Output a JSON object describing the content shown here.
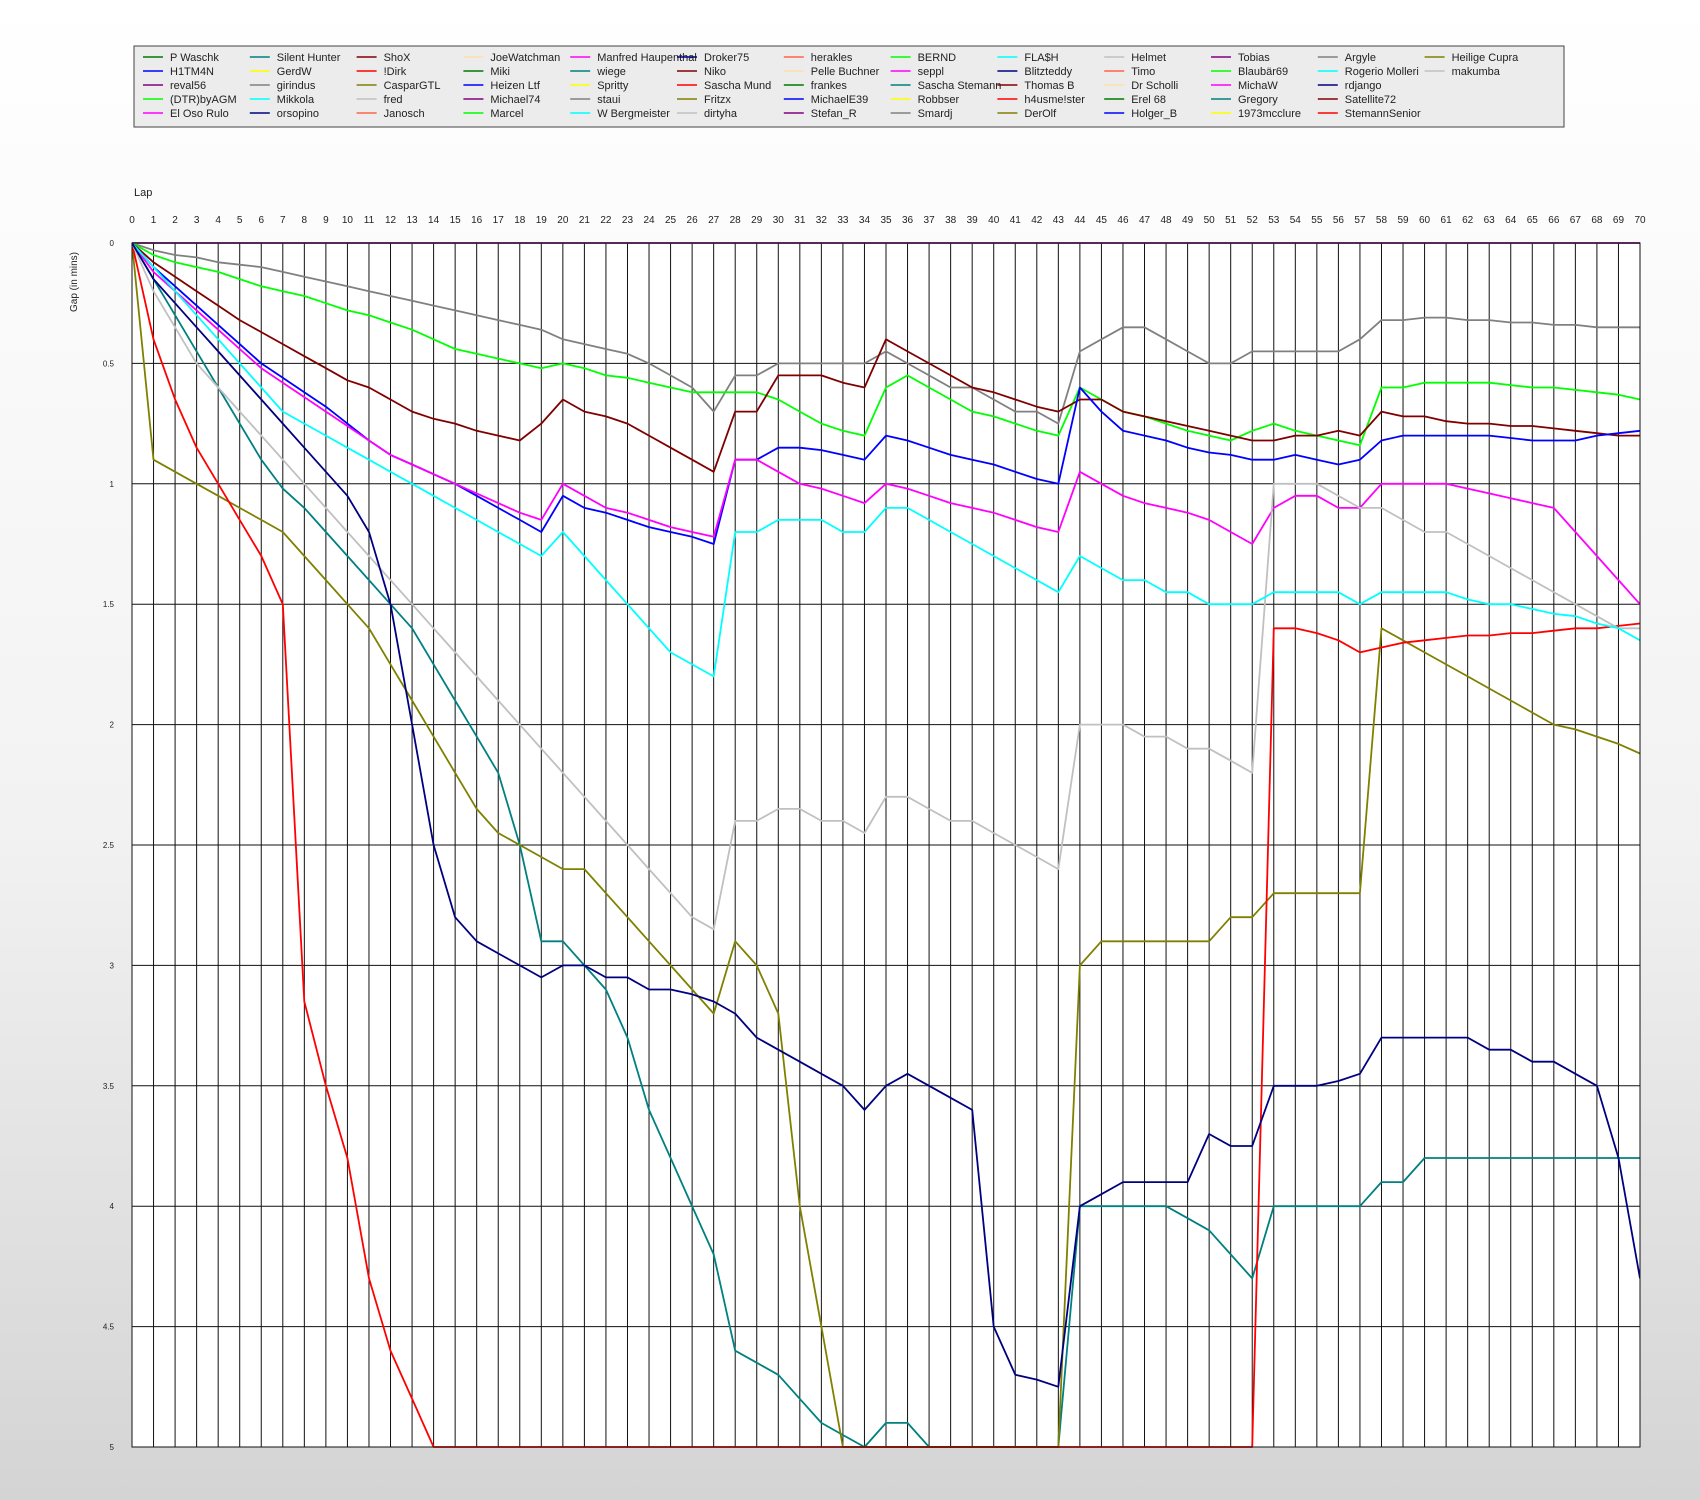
{
  "chart_data": {
    "type": "line",
    "title": "",
    "xlabel": "Lap",
    "ylabel": "Gap (in mins)",
    "x": [
      0,
      1,
      2,
      3,
      4,
      5,
      6,
      7,
      8,
      9,
      10,
      11,
      12,
      13,
      14,
      15,
      16,
      17,
      18,
      19,
      20,
      21,
      22,
      23,
      24,
      25,
      26,
      27,
      28,
      29,
      30,
      31,
      32,
      33,
      34,
      35,
      36,
      37,
      38,
      39,
      40,
      41,
      42,
      43,
      44,
      45,
      46,
      47,
      48,
      49,
      50,
      51,
      52,
      53,
      54,
      55,
      56,
      57,
      58,
      59,
      60,
      61,
      62,
      63,
      64,
      65,
      66,
      67,
      68,
      69,
      70
    ],
    "xlim": [
      0,
      70
    ],
    "ylim": [
      0,
      5
    ],
    "y_inverted": true,
    "yticks": [
      "0",
      "0.5",
      "1",
      "1.5",
      "2",
      "2.5",
      "3",
      "3.5",
      "4",
      "4.5",
      "5"
    ],
    "grid": "vertical line per lap, horizontal line per 0.5",
    "legend_position": "top",
    "legend": [
      {
        "name": "P Waschk",
        "color": "#007800"
      },
      {
        "name": "H1TM4N",
        "color": "#0000ff"
      },
      {
        "name": "reval56",
        "color": "#800080"
      },
      {
        "name": "(DTR)byAGM",
        "color": "#00ff00"
      },
      {
        "name": "El Oso Rulo",
        "color": "#ff00ff"
      },
      {
        "name": "Silent Hunter",
        "color": "#008080"
      },
      {
        "name": "GerdW",
        "color": "#ffff00"
      },
      {
        "name": "girindus",
        "color": "#808080"
      },
      {
        "name": "Mikkola",
        "color": "#00ffff"
      },
      {
        "name": "orsopino",
        "color": "#000080"
      },
      {
        "name": "ShoX",
        "color": "#800000"
      },
      {
        "name": "!Dirk",
        "color": "#ff0000"
      },
      {
        "name": "CasparGTL",
        "color": "#808000"
      },
      {
        "name": "fred",
        "color": "#c0c0c0"
      },
      {
        "name": "Janosch",
        "color": "#ff6347"
      },
      {
        "name": "JoeWatchman",
        "color": "#ffdead"
      },
      {
        "name": "Miki",
        "color": "#007800"
      },
      {
        "name": "Heizen Ltf",
        "color": "#0000ff"
      },
      {
        "name": "Michael74",
        "color": "#800080"
      },
      {
        "name": "Marcel",
        "color": "#00ff00"
      },
      {
        "name": "Manfred Haupenthal",
        "color": "#ff00ff"
      },
      {
        "name": "wiege",
        "color": "#008080"
      },
      {
        "name": "Spritty",
        "color": "#ffff00"
      },
      {
        "name": "staui",
        "color": "#808080"
      },
      {
        "name": "W Bergmeister",
        "color": "#00ffff"
      },
      {
        "name": "Droker75",
        "color": "#000080"
      },
      {
        "name": "Niko",
        "color": "#800000"
      },
      {
        "name": "Sascha Mund",
        "color": "#ff0000"
      },
      {
        "name": "Fritzx",
        "color": "#808000"
      },
      {
        "name": "dirtyha",
        "color": "#c0c0c0"
      },
      {
        "name": "herakles",
        "color": "#ff6347"
      },
      {
        "name": "Pelle Buchner",
        "color": "#ffdead"
      },
      {
        "name": "frankes",
        "color": "#007800"
      },
      {
        "name": "MichaelE39",
        "color": "#0000ff"
      },
      {
        "name": "Stefan_R",
        "color": "#800080"
      },
      {
        "name": "BERND",
        "color": "#00ff00"
      },
      {
        "name": "seppl",
        "color": "#ff00ff"
      },
      {
        "name": "Sascha Stemann",
        "color": "#008080"
      },
      {
        "name": "Robbser",
        "color": "#ffff00"
      },
      {
        "name": "Smardj",
        "color": "#808080"
      },
      {
        "name": "FLA$H",
        "color": "#00ffff"
      },
      {
        "name": "Blitzteddy",
        "color": "#000080"
      },
      {
        "name": "Thomas B",
        "color": "#800000"
      },
      {
        "name": "h4usme!ster",
        "color": "#ff0000"
      },
      {
        "name": "DerOlf",
        "color": "#808000"
      },
      {
        "name": "Helmet",
        "color": "#c0c0c0"
      },
      {
        "name": "Timo",
        "color": "#ff6347"
      },
      {
        "name": "Dr Scholli",
        "color": "#ffdead"
      },
      {
        "name": "Erel 68",
        "color": "#007800"
      },
      {
        "name": "Holger_B",
        "color": "#0000ff"
      },
      {
        "name": "Tobias",
        "color": "#800080"
      },
      {
        "name": "Blaubär69",
        "color": "#00ff00"
      },
      {
        "name": "MichaW",
        "color": "#ff00ff"
      },
      {
        "name": "Gregory",
        "color": "#008080"
      },
      {
        "name": "1973mcclure",
        "color": "#ffff00"
      },
      {
        "name": "Argyle",
        "color": "#808080"
      },
      {
        "name": "Rogerio Molleri",
        "color": "#00ffff"
      },
      {
        "name": "rdjango",
        "color": "#000080"
      },
      {
        "name": "Satellite72",
        "color": "#800000"
      },
      {
        "name": "StemannSenior",
        "color": "#ff0000"
      },
      {
        "name": "Heilige Cupra",
        "color": "#808000"
      },
      {
        "name": "makumba",
        "color": "#c0c0c0"
      }
    ],
    "series": [
      {
        "name": "Tobias",
        "color": "#800080",
        "values": [
          0,
          0,
          0,
          0,
          0,
          0,
          0,
          0,
          0,
          0,
          0,
          0,
          0,
          0,
          0,
          0,
          0,
          0,
          0,
          0,
          0,
          0,
          0,
          0,
          0,
          0,
          0,
          0,
          0,
          0,
          0,
          0,
          0,
          0,
          0,
          0,
          0,
          0,
          0,
          0,
          0,
          0,
          0,
          0,
          0,
          0,
          0,
          0,
          0,
          0,
          0,
          0,
          0,
          0,
          0,
          0,
          0,
          0,
          0,
          0,
          0,
          0,
          0,
          0,
          0,
          0,
          0,
          0,
          0,
          0,
          0
        ]
      },
      {
        "name": "Argyle",
        "color": "#808080",
        "values": [
          0,
          0.03,
          0.05,
          0.06,
          0.08,
          0.09,
          0.1,
          0.12,
          0.14,
          0.16,
          0.18,
          0.2,
          0.22,
          0.24,
          0.26,
          0.28,
          0.3,
          0.32,
          0.34,
          0.36,
          0.4,
          0.42,
          0.44,
          0.46,
          0.5,
          0.55,
          0.6,
          0.7,
          0.55,
          0.55,
          0.5,
          0.5,
          0.5,
          0.5,
          0.5,
          0.45,
          0.5,
          0.55,
          0.6,
          0.6,
          0.65,
          0.7,
          0.7,
          0.75,
          0.45,
          0.4,
          0.35,
          0.35,
          0.4,
          0.45,
          0.5,
          0.5,
          0.45,
          0.45,
          0.45,
          0.45,
          0.45,
          0.4,
          0.32,
          0.32,
          0.31,
          0.31,
          0.32,
          0.32,
          0.33,
          0.33,
          0.34,
          0.34,
          0.35,
          0.35,
          0.35
        ]
      },
      {
        "name": "BERND",
        "color": "#00ff00",
        "values": [
          0,
          0.05,
          0.08,
          0.1,
          0.12,
          0.15,
          0.18,
          0.2,
          0.22,
          0.25,
          0.28,
          0.3,
          0.33,
          0.36,
          0.4,
          0.44,
          0.46,
          0.48,
          0.5,
          0.52,
          0.5,
          0.52,
          0.55,
          0.56,
          0.58,
          0.6,
          0.62,
          0.62,
          0.62,
          0.62,
          0.65,
          0.7,
          0.75,
          0.78,
          0.8,
          0.6,
          0.55,
          0.6,
          0.65,
          0.7,
          0.72,
          0.75,
          0.78,
          0.8,
          0.6,
          0.65,
          0.7,
          0.72,
          0.75,
          0.78,
          0.8,
          0.82,
          0.78,
          0.75,
          0.78,
          0.8,
          0.82,
          0.84,
          0.6,
          0.6,
          0.58,
          0.58,
          0.58,
          0.58,
          0.59,
          0.6,
          0.6,
          0.61,
          0.62,
          0.63,
          0.65
        ]
      },
      {
        "name": "Satellite72",
        "color": "#800000",
        "values": [
          0,
          0.08,
          0.14,
          0.2,
          0.26,
          0.32,
          0.37,
          0.42,
          0.47,
          0.52,
          0.57,
          0.6,
          0.65,
          0.7,
          0.73,
          0.75,
          0.78,
          0.8,
          0.82,
          0.75,
          0.65,
          0.7,
          0.72,
          0.75,
          0.8,
          0.85,
          0.9,
          0.95,
          0.7,
          0.7,
          0.55,
          0.55,
          0.55,
          0.58,
          0.6,
          0.4,
          0.45,
          0.5,
          0.55,
          0.6,
          0.62,
          0.65,
          0.68,
          0.7,
          0.65,
          0.65,
          0.7,
          0.72,
          0.74,
          0.76,
          0.78,
          0.8,
          0.82,
          0.82,
          0.8,
          0.8,
          0.78,
          0.8,
          0.7,
          0.72,
          0.72,
          0.74,
          0.75,
          0.75,
          0.76,
          0.76,
          0.77,
          0.78,
          0.79,
          0.8,
          0.8
        ]
      },
      {
        "name": "H1TM4N",
        "color": "#0000ff",
        "values": [
          0,
          0.1,
          0.18,
          0.26,
          0.34,
          0.42,
          0.5,
          0.56,
          0.62,
          0.68,
          0.75,
          0.82,
          0.88,
          0.92,
          0.96,
          1.0,
          1.05,
          1.1,
          1.15,
          1.2,
          1.05,
          1.1,
          1.12,
          1.15,
          1.18,
          1.2,
          1.22,
          1.25,
          0.9,
          0.9,
          0.85,
          0.85,
          0.86,
          0.88,
          0.9,
          0.8,
          0.82,
          0.85,
          0.88,
          0.9,
          0.92,
          0.95,
          0.98,
          1.0,
          0.6,
          0.7,
          0.78,
          0.8,
          0.82,
          0.85,
          0.87,
          0.88,
          0.9,
          0.9,
          0.88,
          0.9,
          0.92,
          0.9,
          0.82,
          0.8,
          0.8,
          0.8,
          0.8,
          0.8,
          0.81,
          0.82,
          0.82,
          0.82,
          0.8,
          0.79,
          0.78
        ]
      },
      {
        "name": "MichaW",
        "color": "#ff00ff",
        "values": [
          0,
          0.12,
          0.2,
          0.28,
          0.36,
          0.44,
          0.52,
          0.58,
          0.64,
          0.7,
          0.76,
          0.82,
          0.88,
          0.92,
          0.96,
          1.0,
          1.04,
          1.08,
          1.12,
          1.15,
          1.0,
          1.05,
          1.1,
          1.12,
          1.15,
          1.18,
          1.2,
          1.22,
          0.9,
          0.9,
          0.95,
          1.0,
          1.02,
          1.05,
          1.08,
          1.0,
          1.02,
          1.05,
          1.08,
          1.1,
          1.12,
          1.15,
          1.18,
          1.2,
          0.95,
          1.0,
          1.05,
          1.08,
          1.1,
          1.12,
          1.15,
          1.2,
          1.25,
          1.1,
          1.05,
          1.05,
          1.1,
          1.1,
          1.0,
          1.0,
          1.0,
          1.0,
          1.02,
          1.04,
          1.06,
          1.08,
          1.1,
          1.2,
          1.3,
          1.4,
          1.5
        ]
      },
      {
        "name": "Gregory",
        "color": "#008080",
        "values": [
          0,
          0.15,
          0.3,
          0.45,
          0.6,
          0.75,
          0.9,
          1.02,
          1.1,
          1.2,
          1.3,
          1.4,
          1.5,
          1.6,
          1.75,
          1.9,
          2.05,
          2.2,
          2.5,
          2.9,
          2.9,
          3.0,
          3.1,
          3.3,
          3.6,
          3.8,
          4.0,
          4.2,
          4.6,
          4.65,
          4.7,
          4.8,
          4.9,
          4.95,
          5.0,
          4.9,
          4.9,
          5.0,
          5.0,
          5.0,
          5.0,
          5.0,
          5.0,
          5.0,
          4.0,
          4.0,
          4.0,
          4.0,
          4.0,
          4.05,
          4.1,
          4.2,
          4.3,
          4.0,
          4.0,
          4.0,
          4.0,
          4.0,
          3.9,
          3.9,
          3.8,
          3.8,
          3.8,
          3.8,
          3.8,
          3.8,
          3.8,
          3.8,
          3.8,
          3.8,
          3.8
        ]
      },
      {
        "name": "Heilige Cupra",
        "color": "#808000",
        "values": [
          0,
          0.9,
          0.95,
          1.0,
          1.05,
          1.1,
          1.15,
          1.2,
          1.3,
          1.4,
          1.5,
          1.6,
          1.75,
          1.9,
          2.05,
          2.2,
          2.35,
          2.45,
          2.5,
          2.55,
          2.6,
          2.6,
          2.7,
          2.8,
          2.9,
          3.0,
          3.1,
          3.2,
          2.9,
          3.0,
          3.2,
          4.0,
          4.5,
          5.0,
          5.0,
          5.0,
          5.0,
          5.0,
          5.0,
          5.0,
          5.0,
          5.0,
          5.0,
          5.0,
          3.0,
          2.9,
          2.9,
          2.9,
          2.9,
          2.9,
          2.9,
          2.8,
          2.8,
          2.7,
          2.7,
          2.7,
          2.7,
          2.7,
          1.6,
          1.65,
          1.7,
          1.75,
          1.8,
          1.85,
          1.9,
          1.95,
          2.0,
          2.02,
          2.05,
          2.08,
          2.12
        ]
      },
      {
        "name": "StemannSenior",
        "color": "#ff0000",
        "values": [
          0,
          0.4,
          0.65,
          0.85,
          1.0,
          1.15,
          1.3,
          1.5,
          3.15,
          3.5,
          3.8,
          4.3,
          4.6,
          4.8,
          5.0,
          5.0,
          5.0,
          5.0,
          5.0,
          5.0,
          5.0,
          5.0,
          5.0,
          5.0,
          5.0,
          5.0,
          5.0,
          5.0,
          5.0,
          5.0,
          5.0,
          5.0,
          5.0,
          5.0,
          5.0,
          5.0,
          5.0,
          5.0,
          5.0,
          5.0,
          5.0,
          5.0,
          5.0,
          5.0,
          5.0,
          5.0,
          5.0,
          5.0,
          5.0,
          5.0,
          5.0,
          5.0,
          5.0,
          1.6,
          1.6,
          1.62,
          1.65,
          1.7,
          1.68,
          1.66,
          1.65,
          1.64,
          1.63,
          1.63,
          1.62,
          1.62,
          1.61,
          1.6,
          1.6,
          1.59,
          1.58
        ]
      },
      {
        "name": "makumba",
        "color": "#c0c0c0",
        "values": [
          0,
          0.2,
          0.35,
          0.5,
          0.6,
          0.7,
          0.8,
          0.9,
          1.0,
          1.1,
          1.2,
          1.3,
          1.4,
          1.5,
          1.6,
          1.7,
          1.8,
          1.9,
          2.0,
          2.1,
          2.2,
          2.3,
          2.4,
          2.5,
          2.6,
          2.7,
          2.8,
          2.85,
          2.4,
          2.4,
          2.35,
          2.35,
          2.4,
          2.4,
          2.45,
          2.3,
          2.3,
          2.35,
          2.4,
          2.4,
          2.45,
          2.5,
          2.55,
          2.6,
          2.0,
          2.0,
          2.0,
          2.05,
          2.05,
          2.1,
          2.1,
          2.15,
          2.2,
          1.0,
          1.0,
          1.0,
          1.05,
          1.1,
          1.1,
          1.15,
          1.2,
          1.2,
          1.25,
          1.3,
          1.35,
          1.4,
          1.45,
          1.5,
          1.55,
          1.6,
          1.6
        ]
      },
      {
        "name": "Rogerio Molleri",
        "color": "#00ffff",
        "values": [
          0,
          0.1,
          0.2,
          0.3,
          0.4,
          0.5,
          0.6,
          0.7,
          0.75,
          0.8,
          0.85,
          0.9,
          0.95,
          1.0,
          1.05,
          1.1,
          1.15,
          1.2,
          1.25,
          1.3,
          1.2,
          1.3,
          1.4,
          1.5,
          1.6,
          1.7,
          1.75,
          1.8,
          1.2,
          1.2,
          1.15,
          1.15,
          1.15,
          1.2,
          1.2,
          1.1,
          1.1,
          1.15,
          1.2,
          1.25,
          1.3,
          1.35,
          1.4,
          1.45,
          1.3,
          1.35,
          1.4,
          1.4,
          1.45,
          1.45,
          1.5,
          1.5,
          1.5,
          1.45,
          1.45,
          1.45,
          1.45,
          1.5,
          1.45,
          1.45,
          1.45,
          1.45,
          1.48,
          1.5,
          1.5,
          1.52,
          1.54,
          1.55,
          1.58,
          1.6,
          1.65
        ]
      },
      {
        "name": "rdjango",
        "color": "#000080",
        "values": [
          0,
          0.15,
          0.25,
          0.35,
          0.45,
          0.55,
          0.65,
          0.75,
          0.85,
          0.95,
          1.05,
          1.2,
          1.5,
          2.0,
          2.5,
          2.8,
          2.9,
          2.95,
          3.0,
          3.05,
          3.0,
          3.0,
          3.05,
          3.05,
          3.1,
          3.1,
          3.12,
          3.15,
          3.2,
          3.3,
          3.35,
          3.4,
          3.45,
          3.5,
          3.6,
          3.5,
          3.45,
          3.5,
          3.55,
          3.6,
          4.5,
          4.7,
          4.72,
          4.75,
          4.0,
          3.95,
          3.9,
          3.9,
          3.9,
          3.9,
          3.7,
          3.75,
          3.75,
          3.5,
          3.5,
          3.5,
          3.48,
          3.45,
          3.3,
          3.3,
          3.3,
          3.3,
          3.3,
          3.35,
          3.35,
          3.4,
          3.4,
          3.45,
          3.5,
          3.8,
          4.3
        ]
      }
    ]
  }
}
